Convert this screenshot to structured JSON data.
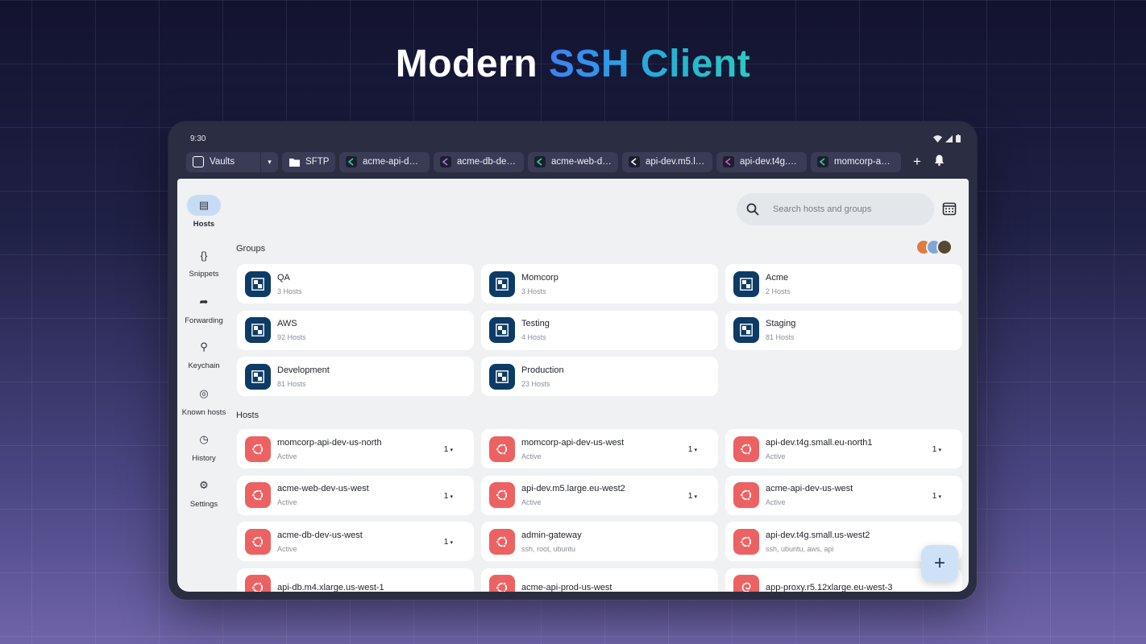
{
  "headline": {
    "prefix": "Modern",
    "accent": "SSH Client"
  },
  "status": {
    "time": "9:30"
  },
  "tabs": [
    {
      "label": "Vaults",
      "icon": "vault-icon",
      "kind": "vaults"
    },
    {
      "label": "SFTP",
      "icon": "folder-icon",
      "kind": "sftp"
    },
    {
      "label": "acme-api-dev-...",
      "icon": "terminal-icon",
      "color": "#2bd6a2"
    },
    {
      "label": "acme-db-dev-...",
      "icon": "terminal-icon",
      "color": "#a77ce0"
    },
    {
      "label": "acme-web-de...",
      "icon": "terminal-icon",
      "color": "#2bd6a2"
    },
    {
      "label": "api-dev.m5.lar...",
      "icon": "terminal-icon",
      "color": "#ffffff"
    },
    {
      "label": "api-dev.t4g.sm...",
      "icon": "terminal-icon",
      "color": "#d257d9"
    },
    {
      "label": "momcorp-api-...",
      "icon": "terminal-icon",
      "color": "#2bd6a2"
    }
  ],
  "nav": [
    {
      "label": "Hosts",
      "icon": "hosts-icon",
      "glyph": "▤",
      "active": true
    },
    {
      "label": "Snippets",
      "icon": "snippets-icon",
      "glyph": "{}"
    },
    {
      "label": "Forwarding",
      "icon": "forwarding-icon",
      "glyph": "➦"
    },
    {
      "label": "Keychain",
      "icon": "key-icon",
      "glyph": "⚲"
    },
    {
      "label": "Known hosts",
      "icon": "fingerprint-icon",
      "glyph": "◎"
    },
    {
      "label": "History",
      "icon": "clock-icon",
      "glyph": "◷"
    },
    {
      "label": "Settings",
      "icon": "gear-icon",
      "glyph": "⚙"
    }
  ],
  "search": {
    "placeholder": "Search hosts and groups"
  },
  "sections": {
    "groups": "Groups",
    "hosts": "Hosts"
  },
  "groups": [
    {
      "name": "QA",
      "sub": "3 Hosts"
    },
    {
      "name": "Momcorp",
      "sub": "3 Hosts"
    },
    {
      "name": "Acme",
      "sub": "2 Hosts"
    },
    {
      "name": "AWS",
      "sub": "92 Hosts"
    },
    {
      "name": "Testing",
      "sub": "4 Hosts"
    },
    {
      "name": "Staging",
      "sub": "81 Hosts"
    },
    {
      "name": "Development",
      "sub": "81 Hosts"
    },
    {
      "name": "Production",
      "sub": "23 Hosts"
    }
  ],
  "hosts": [
    {
      "name": "momcorp-api-dev-us-north",
      "sub": "Active",
      "count": "1",
      "os": "ubuntu"
    },
    {
      "name": "momcorp-api-dev-us-west",
      "sub": "Active",
      "count": "1",
      "os": "ubuntu"
    },
    {
      "name": "api-dev.t4g.small.eu-north1",
      "sub": "Active",
      "count": "1",
      "os": "ubuntu"
    },
    {
      "name": "acme-web-dev-us-west",
      "sub": "Active",
      "count": "1",
      "os": "ubuntu"
    },
    {
      "name": "api-dev.m5.large.eu-west2",
      "sub": "Active",
      "count": "1",
      "os": "ubuntu"
    },
    {
      "name": "acme-api-dev-us-west",
      "sub": "Active",
      "count": "1",
      "os": "ubuntu"
    },
    {
      "name": "acme-db-dev-us-west",
      "sub": "Active",
      "count": "1",
      "os": "ubuntu"
    },
    {
      "name": "admin-gateway",
      "sub": "ssh, root, ubuntu",
      "count": "",
      "os": "ubuntu"
    },
    {
      "name": "api-dev.t4g.small.us-west2",
      "sub": "ssh, ubuntu, aws, api",
      "count": "",
      "os": "ubuntu"
    },
    {
      "name": "api-db.m4.xlarge.us-west-1",
      "sub": "",
      "count": "",
      "os": "ubuntu"
    },
    {
      "name": "acme-api-prod-us-west",
      "sub": "",
      "count": "",
      "os": "ubuntu"
    },
    {
      "name": "app-proxy.r5.12xlarge.eu-west-3",
      "sub": "",
      "count": "",
      "os": "debian"
    }
  ],
  "colors": {
    "group": "#0c3b66",
    "host": "#ec6262",
    "accent": "#c6dcf5"
  },
  "fab": {
    "label": "+"
  },
  "tab_actions": {
    "add": "+",
    "bell": "🔔"
  }
}
